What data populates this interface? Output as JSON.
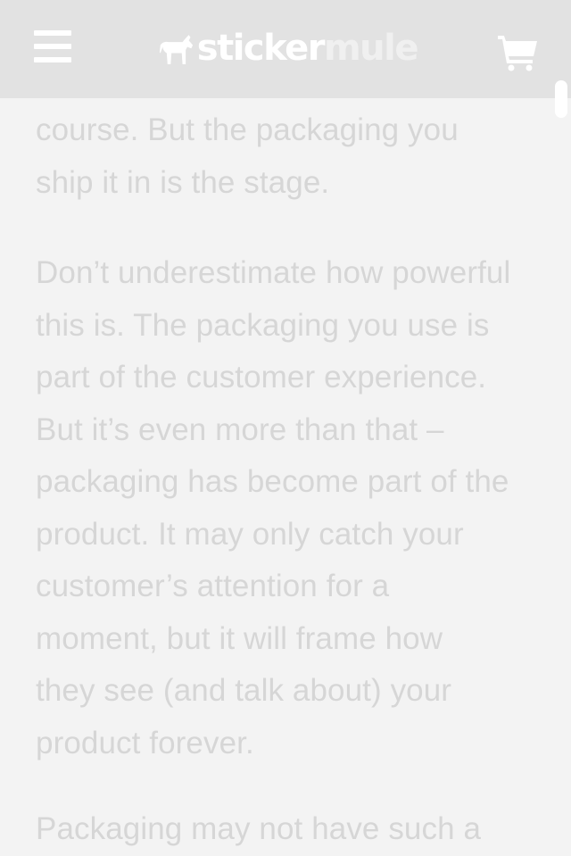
{
  "header": {
    "logo": {
      "word1": "sticker",
      "word2": "mule"
    },
    "menu_icon": "hamburger-menu-icon",
    "cart_icon": "shopping-cart-icon"
  },
  "article": {
    "para1_lines": [
      "course. But the packaging you",
      "ship it in is the stage."
    ],
    "para2_lines": [
      "Don’t underestimate how powerful",
      "this is. The packaging you use is",
      "part of the customer experience.",
      "But it’s even more than that –",
      "packaging has become part of the",
      "product. It may only catch your",
      "customer’s attention for a",
      "moment, but it will frame how",
      "they see (and talk about) your",
      "product forever."
    ],
    "para3_lines": [
      "Packaging may not have such a"
    ]
  },
  "colors": {
    "header_bg": "#e2e2e2",
    "page_bg": "#f3f3f3",
    "text": "#d6d6d6",
    "icon": "#ffffff"
  }
}
